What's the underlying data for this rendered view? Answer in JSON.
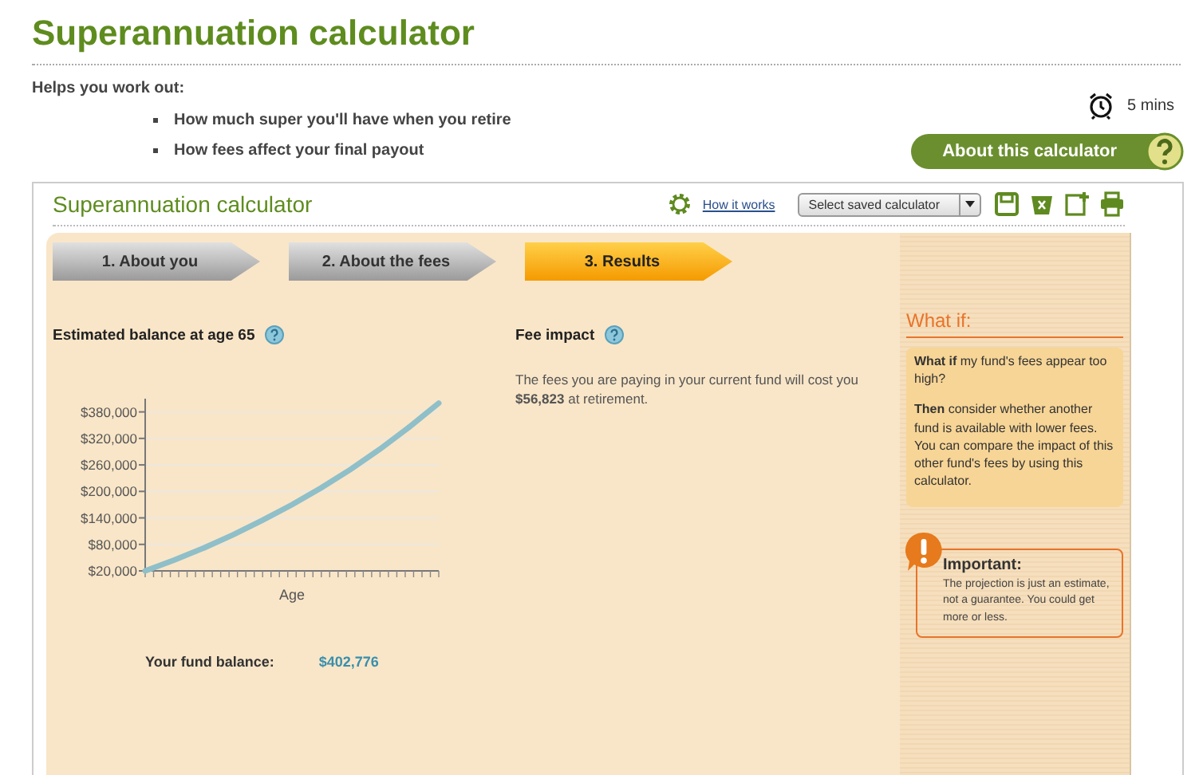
{
  "title": "Superannuation calculator",
  "intro": {
    "heading": "Helps you work out:",
    "bullets": [
      "How much super you'll have when you retire",
      "How fees affect your final payout"
    ]
  },
  "duration": "5 mins",
  "about_button": "About this calculator",
  "calculator": {
    "title": "Superannuation calculator",
    "how_it_works": "How it works",
    "saved_select": "Select saved calculator"
  },
  "steps": [
    {
      "label": "1. About you",
      "selected": false
    },
    {
      "label": "2. About the fees",
      "selected": false
    },
    {
      "label": "3. Results",
      "selected": true
    }
  ],
  "balance": {
    "heading": "Estimated balance at age 65",
    "chart_data": {
      "type": "line",
      "xlabel": "Age",
      "grid": true,
      "ylim": [
        20000,
        410000
      ],
      "yticks": [
        {
          "value": 20000,
          "label": "$20,000"
        },
        {
          "value": 80000,
          "label": "$80,000"
        },
        {
          "value": 140000,
          "label": "$140,000"
        },
        {
          "value": 200000,
          "label": "$200,000"
        },
        {
          "value": 260000,
          "label": "$260,000"
        },
        {
          "value": 320000,
          "label": "$320,000"
        },
        {
          "value": 380000,
          "label": "$380,000"
        }
      ],
      "series": [
        {
          "color": "#8fbfc9",
          "values": [
            20000,
            45000,
            72000,
            102000,
            135000,
            170000,
            208000,
            250000,
            296000,
            346000,
            400000
          ]
        }
      ]
    },
    "fund_label": "Your fund balance:",
    "fund_value": "$402,776"
  },
  "fee_impact": {
    "heading": "Fee impact",
    "text": "The fees you are paying in your current fund will cost you **$56,823** at retirement."
  },
  "what_if": {
    "heading": "What if:",
    "paragraphs": [
      "**What if** my fund's fees appear too high?",
      "**Then** consider whether another fund is available with lower fees. You can compare the impact of this other fund's fees by using this calculator."
    ]
  },
  "important": {
    "heading": "Important:",
    "text": "The projection is just an estimate, not a guarantee. You could get more or less."
  }
}
